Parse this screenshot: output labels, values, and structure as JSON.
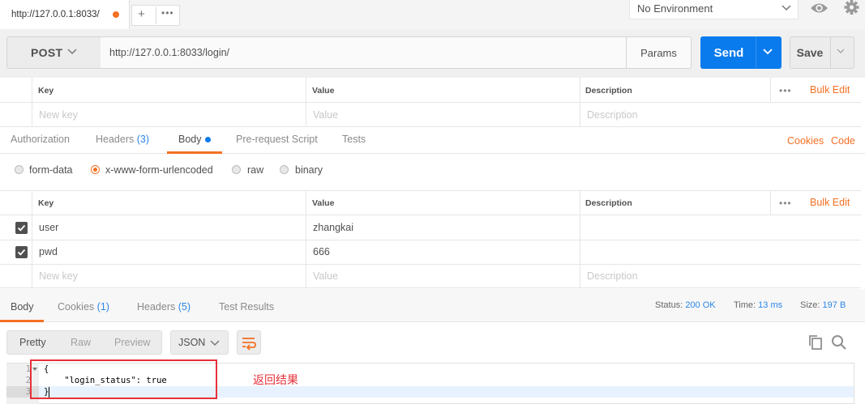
{
  "tab": {
    "title": "http://127.0.0.1:8033/",
    "add_label": "+",
    "more_label": "•••"
  },
  "environment": {
    "selected": "No Environment"
  },
  "request": {
    "method": "POST",
    "url": "http://127.0.0.1:8033/login/",
    "params_label": "Params",
    "send_label": "Send",
    "save_label": "Save"
  },
  "param_table": {
    "headers": {
      "key": "Key",
      "value": "Value",
      "description": "Description"
    },
    "new_key": "New key",
    "new_value": "Value",
    "new_description": "Description",
    "more_label": "•••",
    "bulk_edit": "Bulk Edit"
  },
  "request_tabs": {
    "authorization": "Authorization",
    "headers": "Headers",
    "headers_count": "(3)",
    "body": "Body",
    "prerequest": "Pre-request Script",
    "tests": "Tests",
    "cookies": "Cookies",
    "code": "Code",
    "active": "Body"
  },
  "body_modes": {
    "form_data": "form-data",
    "urlencoded": "x-www-form-urlencoded",
    "raw": "raw",
    "binary": "binary",
    "selected": "x-www-form-urlencoded"
  },
  "body_table": {
    "headers": {
      "key": "Key",
      "value": "Value",
      "description": "Description"
    },
    "rows": [
      {
        "key": "user",
        "value": "zhangkai",
        "checked": true
      },
      {
        "key": "pwd",
        "value": "666",
        "checked": true
      }
    ],
    "new_key": "New key",
    "new_value": "Value",
    "new_description": "Description",
    "more_label": "•••",
    "bulk_edit": "Bulk Edit"
  },
  "response_tabs": {
    "body": "Body",
    "cookies": "Cookies",
    "cookies_count": "(1)",
    "headers": "Headers",
    "headers_count": "(5)",
    "test_results": "Test Results",
    "active": "Body"
  },
  "response_meta": {
    "status_label": "Status:",
    "status_value": "200 OK",
    "time_label": "Time:",
    "time_value": "13 ms",
    "size_label": "Size:",
    "size_value": "197 B"
  },
  "response_view": {
    "pretty": "Pretty",
    "raw": "Raw",
    "preview": "Preview",
    "format": "JSON",
    "active": "Pretty"
  },
  "response_body": {
    "line_numbers": [
      "1",
      "2",
      "3"
    ],
    "lines": [
      "{",
      "    \"login_status\": true",
      "}"
    ]
  },
  "annotation": {
    "text": "返回结果"
  },
  "colors": {
    "accent": "#f47023",
    "send": "#097bed",
    "annotation": "#e8303a",
    "count": "#2a86e8"
  },
  "icons": [
    "chevron-down-icon",
    "eye-icon",
    "gear-icon",
    "checkbox-checked-icon",
    "wrap-lines-icon",
    "copy-icon",
    "search-icon",
    "fold-arrow-icon"
  ]
}
